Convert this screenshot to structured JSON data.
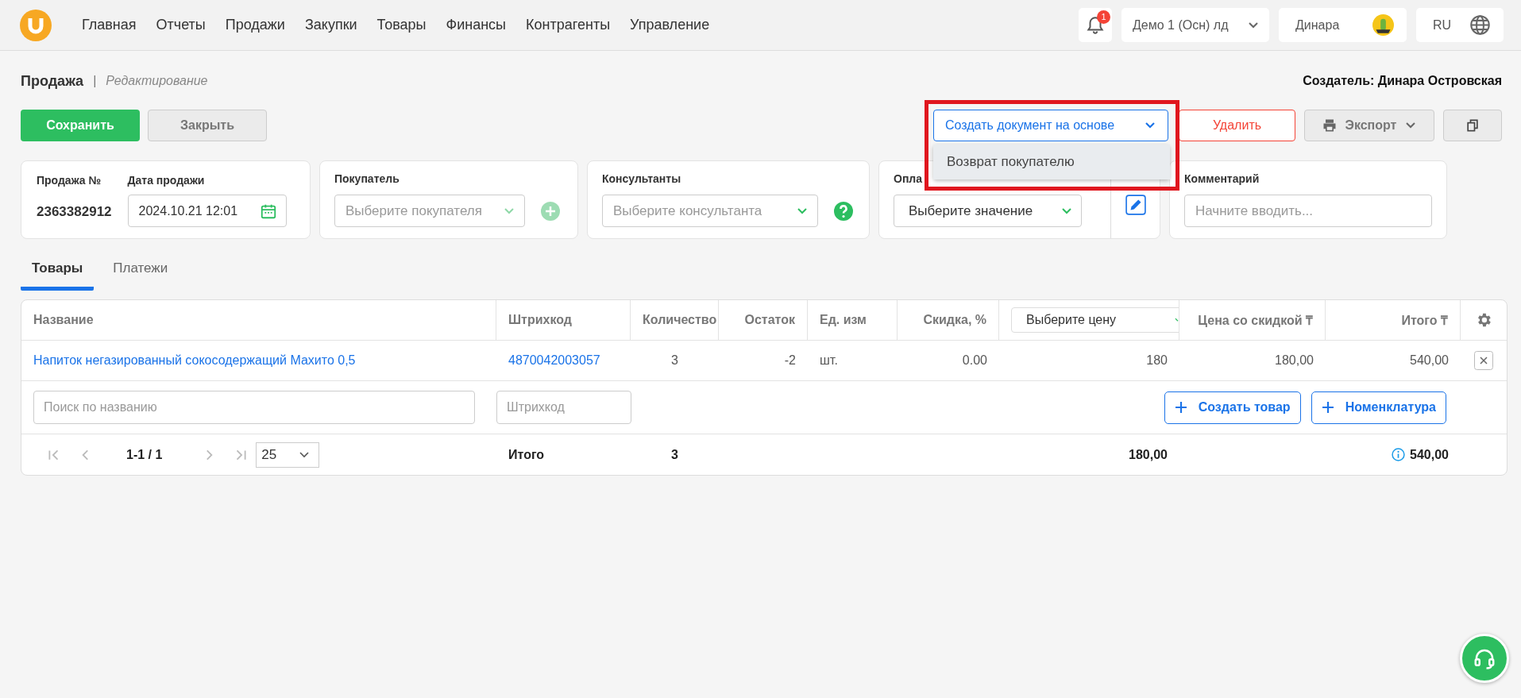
{
  "nav": {
    "items": [
      "Главная",
      "Отчеты",
      "Продажи",
      "Закупки",
      "Товары",
      "Финансы",
      "Контрагенты",
      "Управление"
    ]
  },
  "notifications": {
    "count": "1"
  },
  "org_select": {
    "value": "Демо 1 (Осн) лд"
  },
  "user": {
    "name": "Динара"
  },
  "language": {
    "value": "RU"
  },
  "page": {
    "title": "Продажа",
    "separator": "|",
    "mode": "Редактирование",
    "creator": "Создатель: Динара Островская"
  },
  "actions": {
    "save": "Сохранить",
    "close": "Закрыть",
    "create_based": "Создать документ на основе",
    "delete": "Удалить",
    "export": "Экспорт"
  },
  "create_menu": {
    "items": [
      "Возврат покупателю"
    ]
  },
  "form": {
    "sale_number": {
      "label": "Продажа №",
      "value": "2363382912"
    },
    "sale_date": {
      "label": "Дата продажи",
      "value": "2024.10.21 12:01"
    },
    "buyer": {
      "label": "Покупатель",
      "placeholder": "Выберите покупателя"
    },
    "consultants": {
      "label": "Консультанты",
      "placeholder": "Выберите консультанта"
    },
    "payment": {
      "label": "Опла",
      "value": "Выберите значение"
    },
    "comment": {
      "label": "Комментарий",
      "placeholder": "Начните вводить..."
    }
  },
  "tabs": [
    {
      "label": "Товары",
      "selected": true
    },
    {
      "label": "Платежи",
      "selected": false
    }
  ],
  "table": {
    "columns": [
      "Название",
      "Штрихкод",
      "Количество",
      "Остаток",
      "Ед. изм",
      "Скидка, %",
      "",
      "Цена со скидкой ₸",
      "Итого ₸"
    ],
    "price_select": {
      "value": "Выберите цену"
    },
    "rows": [
      {
        "name": "Напиток негазированный сокосодержащий Махито 0,5",
        "barcode": "4870042003057",
        "quantity": "3",
        "remainder": "-2",
        "unit": "шт.",
        "discount": "0.00",
        "price": "180",
        "discounted_price": "180,00",
        "total": "540,00"
      }
    ],
    "search": {
      "name_placeholder": "Поиск по названию",
      "barcode_placeholder": "Штрихкод"
    },
    "buttons": [
      "Создать товар",
      "Номенклатура"
    ],
    "pagination": {
      "range": "1-1 / 1",
      "page_size": "25"
    },
    "totals": {
      "label": "Итого",
      "quantity": "3",
      "price": "180,00",
      "total": "540,00"
    }
  }
}
